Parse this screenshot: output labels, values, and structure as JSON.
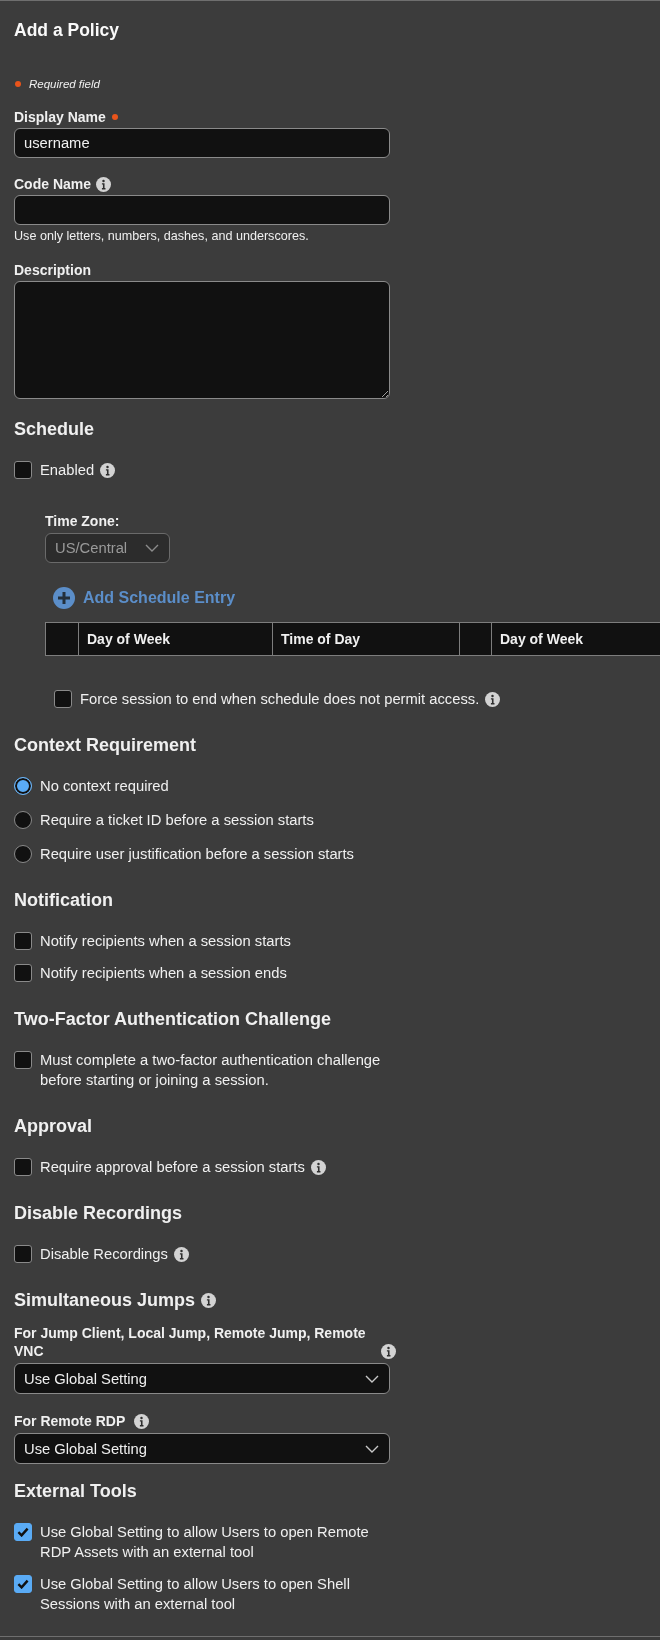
{
  "title": "Add a Policy",
  "required_note": "Required field",
  "fields": [
    {
      "kind": "input",
      "label": "Display Name",
      "required": true,
      "value": "username"
    },
    {
      "kind": "input",
      "label": "Code Name",
      "info": true,
      "hint": "Use only letters, numbers, dashes, and underscores."
    },
    {
      "kind": "textarea",
      "label": "Description"
    }
  ],
  "sections": [
    {
      "heading": "Schedule",
      "items": [
        {
          "kind": "checkbox",
          "label": "Enabled",
          "checked": false,
          "info": true,
          "children": [
            {
              "kind": "select",
              "label": "Time Zone:",
              "value": "US/Central",
              "disabled": true
            },
            {
              "kind": "add_button",
              "label": "Add Schedule Entry"
            },
            {
              "kind": "table",
              "columns": [
                {
                  "kind": "blank"
                },
                {
                  "kind": "heading",
                  "label": "Day of Week"
                },
                {
                  "kind": "heading",
                  "label": "Time of Day"
                },
                {
                  "kind": "blank"
                },
                {
                  "kind": "heading",
                  "label": "Day of Week"
                }
              ]
            },
            {
              "kind": "checkbox",
              "label": "Force session to end when schedule does not permit access.",
              "checked": false,
              "info": true
            }
          ]
        }
      ]
    },
    {
      "heading": "Context Requirement",
      "items": [
        {
          "kind": "radio",
          "label": "No context required",
          "selected": true
        },
        {
          "kind": "radio",
          "label": "Require a ticket ID before a session starts",
          "selected": false
        },
        {
          "kind": "radio",
          "label": "Require user justification before a session starts",
          "selected": false
        }
      ]
    },
    {
      "heading": "Notification",
      "items": [
        {
          "kind": "checkbox",
          "label": "Notify recipients when a session starts",
          "checked": false
        },
        {
          "kind": "checkbox",
          "label": "Notify recipients when a session ends",
          "checked": false
        }
      ]
    },
    {
      "heading": "Two-Factor Authentication Challenge",
      "items": [
        {
          "kind": "checkbox",
          "label": "Must complete a two-factor authentication challenge before starting or joining a session.",
          "checked": false
        }
      ]
    },
    {
      "heading": "Approval",
      "items": [
        {
          "kind": "checkbox",
          "label": "Require approval before a session starts",
          "checked": false,
          "info": true
        }
      ]
    },
    {
      "heading": "Disable Recordings",
      "items": [
        {
          "kind": "checkbox",
          "label": "Disable Recordings",
          "checked": false,
          "info": true
        }
      ]
    },
    {
      "heading": "Simultaneous Jumps",
      "info": true,
      "items": [
        {
          "kind": "select",
          "label": "For Jump Client, Local Jump, Remote Jump, Remote VNC",
          "info": true,
          "value": "Use Global Setting"
        },
        {
          "kind": "select",
          "label": "For Remote RDP",
          "info": true,
          "value": "Use Global Setting"
        }
      ]
    },
    {
      "heading": "External Tools",
      "items": [
        {
          "kind": "checkbox",
          "label": "Use Global Setting to allow Users to open Remote RDP Assets with an external tool",
          "checked": true
        },
        {
          "kind": "checkbox",
          "label": "Use Global Setting to allow Users to open Shell Sessions with an external tool",
          "checked": true
        }
      ]
    }
  ]
}
